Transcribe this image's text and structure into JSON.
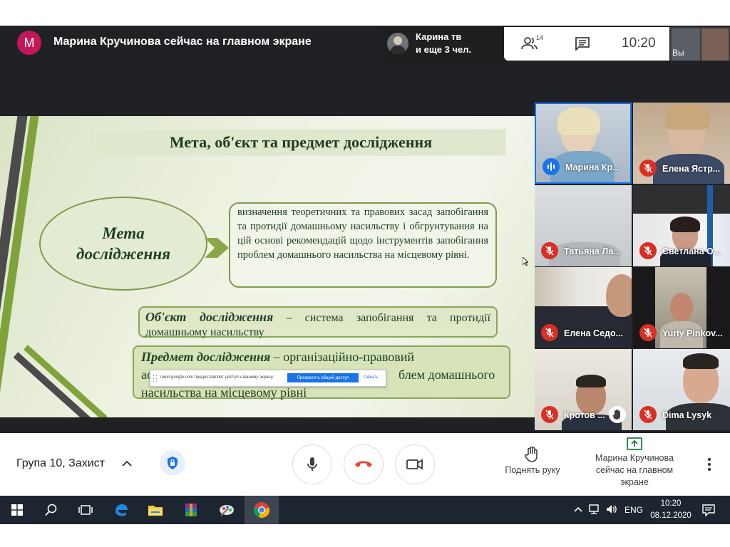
{
  "header": {
    "presenter_initial": "M",
    "presenting_title": "Марина Кручинова сейчас на главном экране",
    "others_line1": "Карина тв",
    "others_line2": "и еще 3 чел.",
    "participants_count": "14",
    "time": "10:20",
    "self_label": "Вы"
  },
  "slide": {
    "title": "Мета, об'єкт та предмет дослідження",
    "goal_label_1": "Мета",
    "goal_label_2": "дослідження",
    "goal_text": "визначення теоретичних та правових засад запобігання та протидії домашньому насильству і обгрунтування на цій основі рекомендацій щодо інструментів запобігання проблем домашнього насильства на місцевому рівні.",
    "object_label": "Об'єкт дослідження",
    "object_text": " – система запобігання та протидії домашньому насильству",
    "subject_label": "Предмет дослідження",
    "subject_text_1": " – організаційно-правовий",
    "subject_text_2": "ас",
    "subject_text_3": "блем домашнього",
    "subject_text_4": "насильства на місцевому рівні"
  },
  "share_bar": {
    "text": "meet.google.com предоставляет доступ к вашему экрану.",
    "stop_label": "Прекратить общий доступ",
    "hide_label": "Скрыть"
  },
  "participants": [
    {
      "name": "Марина Кр...",
      "status": "speaking"
    },
    {
      "name": "Елена Ястр...",
      "status": "muted"
    },
    {
      "name": "Татьяна Ла...",
      "status": "muted"
    },
    {
      "name": "Светлана О...",
      "status": "muted"
    },
    {
      "name": "Елена Седо...",
      "status": "muted"
    },
    {
      "name": "Yuriy Pinkov...",
      "status": "muted"
    },
    {
      "name": "Кротов ...",
      "status": "muted-hand-raised"
    },
    {
      "name": "Dima Lysyk",
      "status": "muted"
    }
  ],
  "bottom": {
    "meeting_name": "Група 10, Захист",
    "raise_hand": "Поднять руку",
    "present_line1": "Марина Кручинова",
    "present_line2": "сейчас на главном",
    "present_line3": "экране"
  },
  "taskbar": {
    "language": "ENG",
    "clock_time": "10:20",
    "clock_date": "08.12.2020",
    "apps": [
      "start-icon",
      "search-icon",
      "task-view-icon",
      "edge-icon",
      "file-explorer-icon",
      "winrar-icon",
      "paint-icon",
      "chrome-icon"
    ]
  },
  "colors": {
    "accent": "#1a73e8",
    "mic_off": "#d93025",
    "slide_text": "#1f3f25",
    "presenter_avatar": "#c2185b",
    "hangup": "#ea4335"
  }
}
